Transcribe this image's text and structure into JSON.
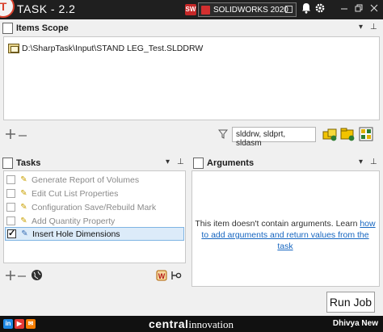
{
  "titlebar": {
    "title": "TASK - 2.2",
    "logo_letter": "T",
    "solidworks_select": "SOLIDWORKS 2020",
    "sw_badge": "SW",
    "icons": [
      "solidworks-icon",
      "bell-icon",
      "gear-icon"
    ],
    "window_controls": [
      "minimize",
      "restore",
      "close"
    ]
  },
  "items_scope": {
    "header": "Items Scope",
    "items": [
      "D:\\SharpTask\\Input\\STAND LEG_Test.SLDDRW"
    ],
    "filter_value": "slddrw, sldprt, sldasm"
  },
  "tasks": {
    "header": "Tasks",
    "items": [
      {
        "label": "Generate Report of Volumes",
        "checked": false,
        "active": false
      },
      {
        "label": "Edit Cut List Properties",
        "checked": false,
        "active": false
      },
      {
        "label": "Configuration Save/Rebuild Mark",
        "checked": false,
        "active": false
      },
      {
        "label": "Add Quantity Property",
        "checked": false,
        "active": false
      },
      {
        "label": "Insert Hole Dimensions",
        "checked": true,
        "active": true
      }
    ]
  },
  "arguments": {
    "header": "Arguments",
    "message": "This item doesn't contain arguments. Learn",
    "link": "how to add arguments and return values from the task"
  },
  "run_button": "Run Job",
  "footer": {
    "brand_bold": "central",
    "brand_light": "innovation",
    "user": "Dhivya New",
    "social_linkedin": "in",
    "social_youtube": "▶",
    "social_mail": "✉"
  }
}
